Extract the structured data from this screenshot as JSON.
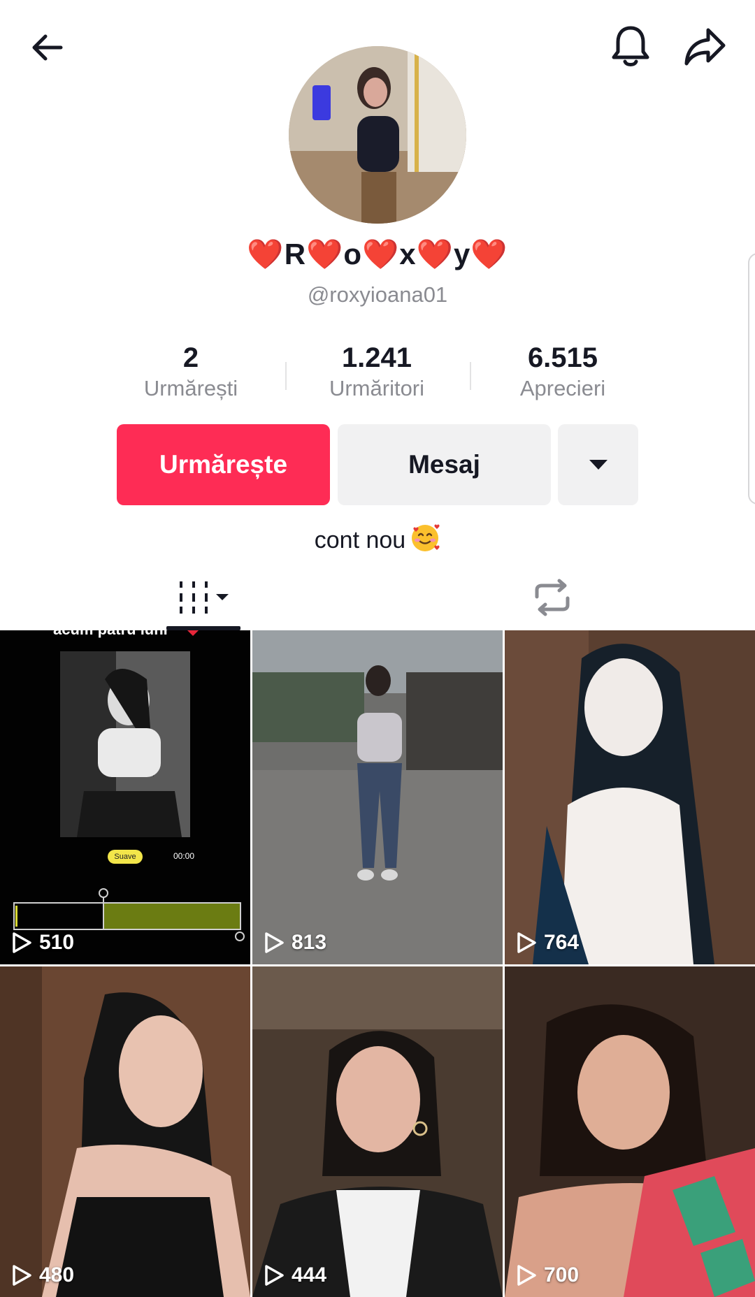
{
  "header": {
    "back_icon": "arrow-left-icon",
    "bell_icon": "bell-icon",
    "share_icon": "share-arrow-icon"
  },
  "profile": {
    "display_name_parts": [
      "❤️",
      "R",
      "❤️",
      "o",
      "❤️",
      "x",
      "❤️",
      "y",
      "❤️"
    ],
    "username": "@roxyioana01",
    "bio": "cont nou",
    "bio_emoji": "smiling-face-with-hearts-icon"
  },
  "stats": [
    {
      "value": "2",
      "label": "Urmărești"
    },
    {
      "value": "1.241",
      "label": "Urmăritori"
    },
    {
      "value": "6.515",
      "label": "Aprecieri"
    }
  ],
  "actions": {
    "follow_label": "Urmărește",
    "message_label": "Mesaj",
    "more_icon": "caret-down-icon"
  },
  "tabs": {
    "videos_icon": "video-grid-icon",
    "reposts_icon": "repost-icon"
  },
  "colors": {
    "accent": "#fe2c55",
    "secondary_button": "#f1f1f2",
    "muted_text": "#8a8b91"
  },
  "videos": [
    {
      "views": "510",
      "caption": "acum patru luni",
      "pill": "Suave",
      "time": "00:00"
    },
    {
      "views": "813"
    },
    {
      "views": "764"
    },
    {
      "views": "480"
    },
    {
      "views": "444"
    },
    {
      "views": "700"
    }
  ]
}
